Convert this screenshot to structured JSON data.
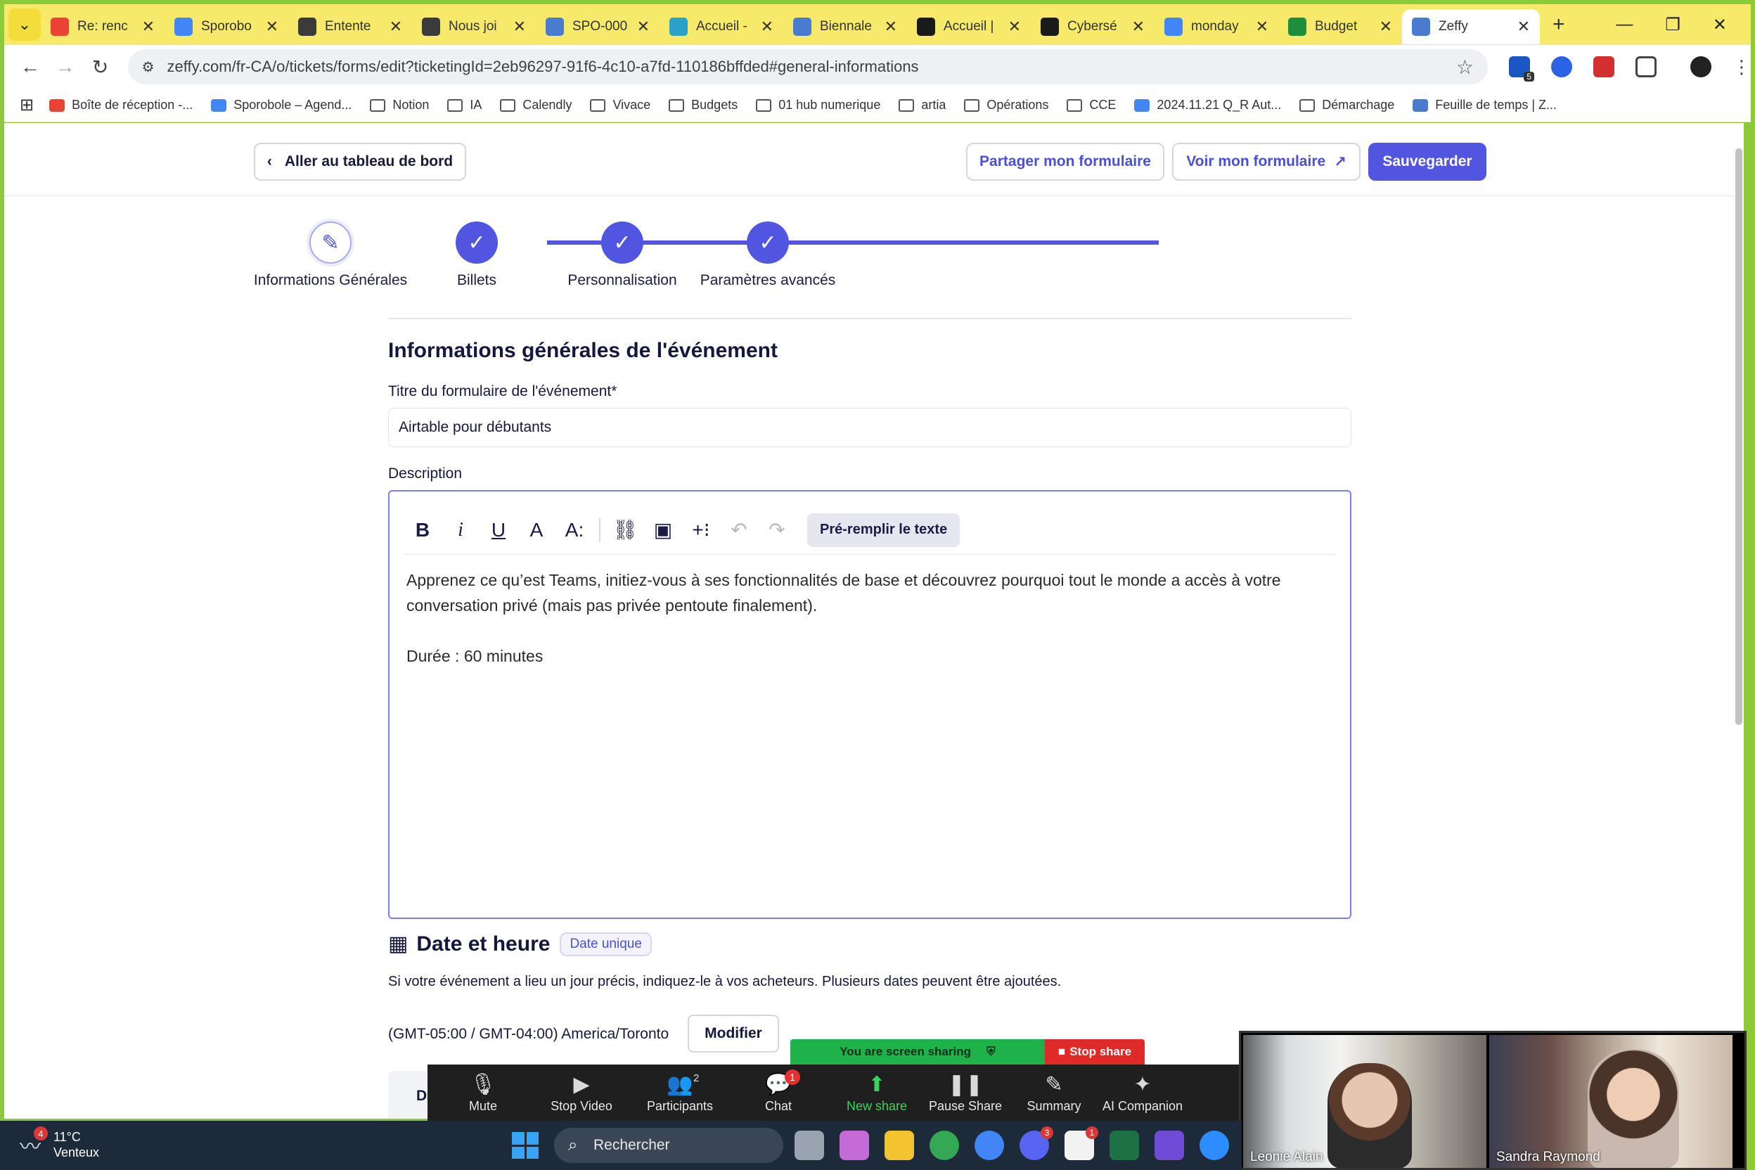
{
  "browser": {
    "tabs": [
      {
        "title": "Re: renc",
        "icon": "gmail-icon",
        "color": "#ea4335"
      },
      {
        "title": "Sporobo",
        "icon": "calendar-icon",
        "color": "#4285f4"
      },
      {
        "title": "Entente",
        "icon": "doc-icon",
        "color": "#3b3b3b"
      },
      {
        "title": "Nous joi",
        "icon": "doc-icon",
        "color": "#3b3b3b"
      },
      {
        "title": "SPO-000",
        "icon": "zeffy-icon",
        "color": "#4a7bd0"
      },
      {
        "title": "Accueil -",
        "icon": "c-icon",
        "color": "#2aa1c8"
      },
      {
        "title": "Biennale",
        "icon": "zeffy-icon",
        "color": "#4a7bd0"
      },
      {
        "title": "Accueil |",
        "icon": "o1-icon",
        "color": "#1a1a1a"
      },
      {
        "title": "Cybersé",
        "icon": "o1-icon",
        "color": "#1a1a1a"
      },
      {
        "title": "monday",
        "icon": "google-icon",
        "color": "#4285f4"
      },
      {
        "title": "Budget",
        "icon": "sheets-icon",
        "color": "#1e8e3e"
      },
      {
        "title": "Zeffy",
        "icon": "zeffy-icon",
        "color": "#4a7bd0",
        "active": true
      }
    ],
    "url": "zeffy.com/fr-CA/o/tickets/forms/edit?ticketingId=2eb96297-91f6-4c10-a7fd-110186bffded#general-informations",
    "extension_badge": "5",
    "bookmarks": [
      {
        "label": "Boîte de réception -...",
        "icon": "gmail-icon",
        "color": "#ea4335"
      },
      {
        "label": "Sporobole – Agend...",
        "icon": "calendar-icon",
        "color": "#4285f4"
      },
      {
        "label": "Notion",
        "icon": "folder-icon"
      },
      {
        "label": "IA",
        "icon": "folder-icon"
      },
      {
        "label": "Calendly",
        "icon": "folder-icon"
      },
      {
        "label": "Vivace",
        "icon": "folder-icon"
      },
      {
        "label": "Budgets",
        "icon": "folder-icon"
      },
      {
        "label": "01 hub numerique",
        "icon": "folder-icon"
      },
      {
        "label": "artia",
        "icon": "folder-icon"
      },
      {
        "label": "Opérations",
        "icon": "folder-icon"
      },
      {
        "label": "CCE",
        "icon": "folder-icon"
      },
      {
        "label": "2024.11.21 Q_R Aut...",
        "icon": "docs-icon",
        "color": "#4285f4"
      },
      {
        "label": "Démarchage",
        "icon": "folder-icon"
      },
      {
        "label": "Feuille de temps | Z...",
        "icon": "zeffy-icon",
        "color": "#4a7bd0"
      }
    ]
  },
  "header": {
    "back_label": "Aller au tableau de bord",
    "share_label": "Partager mon formulaire",
    "view_label": "Voir mon formulaire",
    "save_label": "Sauvegarder"
  },
  "stepper": {
    "steps": [
      {
        "label": "Informations Générales",
        "state": "current"
      },
      {
        "label": "Billets",
        "state": "done"
      },
      {
        "label": "Personnalisation",
        "state": "done"
      },
      {
        "label": "Paramètres avancés",
        "state": "done"
      }
    ]
  },
  "general": {
    "section_title": "Informations générales de l'événement",
    "title_label": "Titre du formulaire de l'événement*",
    "title_value": "Airtable pour débutants",
    "description_label": "Description",
    "prefill_label": "Pré-remplir le texte",
    "description_p1": "Apprenez ce qu’est Teams, initiez-vous à ses fonctionnalités de base et découvrez pourquoi tout le monde a accès à votre conversation privé (mais pas privée pentoute finalement).",
    "description_p2": "Durée : 60 minutes"
  },
  "date": {
    "title": "Date et heure",
    "badge": "Date unique",
    "description": "Si votre événement a lieu un jour précis, indiquez-le à vos acheteurs. Plusieurs dates peuvent être ajoutées.",
    "timezone": "(GMT-05:00 / GMT-04:00) America/Toronto",
    "modify_label": "Modifier",
    "table_head_partial": "Da"
  },
  "zoom": {
    "sharing_text": "You are screen sharing",
    "stop_share": "Stop share",
    "controls": [
      {
        "label": "Mute",
        "icon": "mic-icon"
      },
      {
        "label": "Stop Video",
        "icon": "video-icon"
      },
      {
        "label": "Participants",
        "icon": "participants-icon",
        "count": "2"
      },
      {
        "label": "Chat",
        "icon": "chat-icon",
        "badge": "1"
      },
      {
        "label": "New share",
        "icon": "share-icon"
      },
      {
        "label": "Pause Share",
        "icon": "pause-icon"
      },
      {
        "label": "Summary",
        "icon": "summary-icon"
      },
      {
        "label": "AI Companion",
        "icon": "ai-icon"
      }
    ],
    "participants": [
      {
        "name": "Leonie Alain"
      },
      {
        "name": "Sandra Raymond"
      }
    ]
  },
  "taskbar": {
    "weather_temp": "11°C",
    "weather_desc": "Venteux",
    "weather_badge": "4",
    "search_placeholder": "Rechercher",
    "apps": [
      {
        "name": "task-view",
        "color": "#9aa4b0"
      },
      {
        "name": "copilot",
        "color": "#c56bd6"
      },
      {
        "name": "file-explorer",
        "color": "#f4c430"
      },
      {
        "name": "chrome",
        "color": "#34a853"
      },
      {
        "name": "chrome-profile",
        "color": "#4285f4"
      },
      {
        "name": "discord",
        "color": "#5865f2",
        "badge": "3"
      },
      {
        "name": "notion",
        "color": "#f2f2f2",
        "badge": "1"
      },
      {
        "name": "excel",
        "color": "#1e7145"
      },
      {
        "name": "app-q",
        "color": "#6f4bd8"
      },
      {
        "name": "zoom",
        "color": "#2d8cff"
      }
    ]
  }
}
